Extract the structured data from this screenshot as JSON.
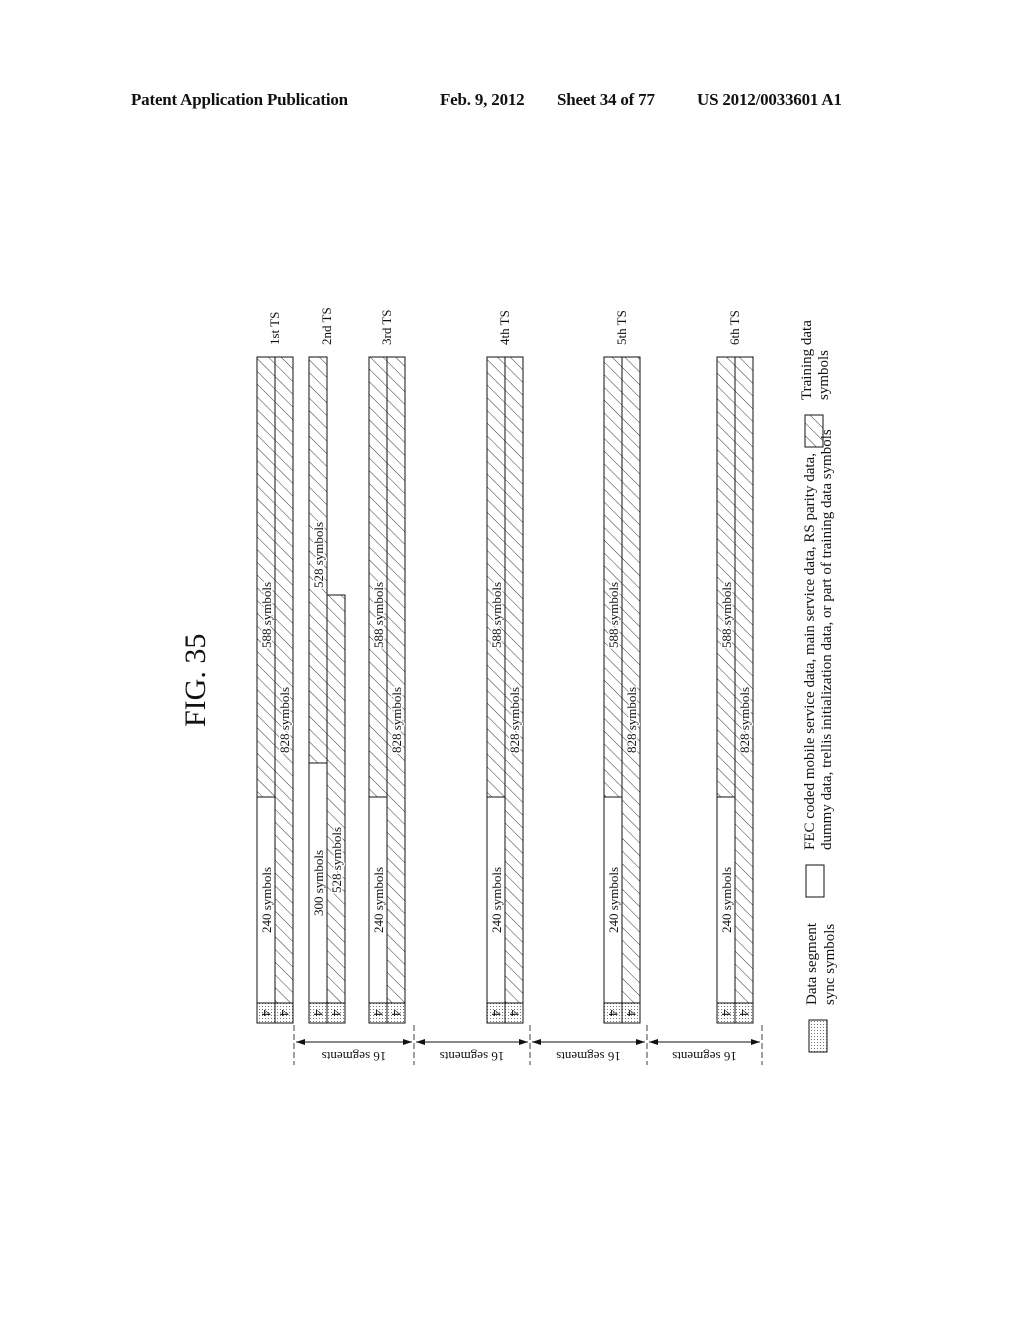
{
  "header": {
    "publication": "Patent Application Publication",
    "date": "Feb. 9, 2012",
    "sheet": "Sheet 34 of 77",
    "number": "US 2012/0033601 A1"
  },
  "figure": {
    "title": "FIG. 35",
    "segment_label": "16 segments",
    "sync_label": "4",
    "transmission_slots": [
      {
        "label": "1st TS",
        "rows": [
          {
            "sync": "4",
            "data_label": "240 symbols",
            "training_label": "588 symbols"
          },
          {
            "sync": "4",
            "training_label": "828 symbols"
          }
        ]
      },
      {
        "label": "2nd TS",
        "rows": [
          {
            "sync": "4",
            "data_label": "300 symbols",
            "training_label": "528 symbols"
          },
          {
            "sync": "4",
            "training_label": "528 symbols"
          }
        ]
      },
      {
        "label": "3rd TS",
        "rows": [
          {
            "sync": "4",
            "data_label": "240 symbols",
            "training_label": "588 symbols"
          },
          {
            "sync": "4",
            "training_label": "828 symbols"
          }
        ]
      },
      {
        "label": "4th TS",
        "rows": [
          {
            "sync": "4",
            "data_label": "240 symbols",
            "training_label": "588 symbols"
          },
          {
            "sync": "4",
            "training_label": "828 symbols"
          }
        ]
      },
      {
        "label": "5th TS",
        "rows": [
          {
            "sync": "4",
            "data_label": "240 symbols",
            "training_label": "588 symbols"
          },
          {
            "sync": "4",
            "training_label": "828 symbols"
          }
        ]
      },
      {
        "label": "6th TS",
        "rows": [
          {
            "sync": "4",
            "data_label": "240 symbols",
            "training_label": "588 symbols"
          },
          {
            "sync": "4",
            "training_label": "828 symbols"
          }
        ]
      }
    ],
    "legend": {
      "sync": "Data segment sync symbols",
      "sync_lines": [
        "Data segment",
        "sync symbols"
      ],
      "data_lines": [
        "FEC coded mobile service data, main service data, RS parity data,",
        "dummy data, trellis initialization data, or part of training data symbols"
      ],
      "training_lines": [
        "Training data",
        "symbols"
      ]
    }
  }
}
